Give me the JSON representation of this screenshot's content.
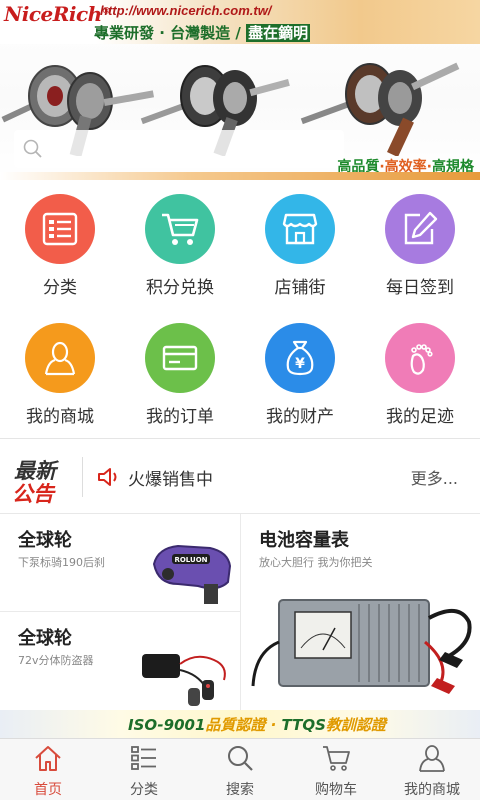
{
  "banner": {
    "brand": "NiceRich",
    "brand_mark": "®",
    "url": "http://www.nicerich.com.tw/",
    "slogan_a": "專業研發 · 台灣製造 / ",
    "slogan_b": "盡在鏑明",
    "tagline_a": "高品質",
    "tagline_sep": "·",
    "tagline_b": "高效率",
    "tagline_c": "高規格"
  },
  "search": {
    "icon": "search-icon"
  },
  "grid": [
    {
      "label": "分类",
      "icon": "list-icon",
      "color": "#f25d4a"
    },
    {
      "label": "积分兑换",
      "icon": "cart-icon",
      "color": "#40c3a0"
    },
    {
      "label": "店铺街",
      "icon": "shop-icon",
      "color": "#33b6e8"
    },
    {
      "label": "每日签到",
      "icon": "edit-icon",
      "color": "#a77be0"
    },
    {
      "label": "我的商城",
      "icon": "user-icon",
      "color": "#f59a1c"
    },
    {
      "label": "我的订单",
      "icon": "card-icon",
      "color": "#6cc04a"
    },
    {
      "label": "我的财产",
      "icon": "money-bag-icon",
      "color": "#2b8ce8"
    },
    {
      "label": "我的足迹",
      "icon": "footprint-icon",
      "color": "#f07cb7"
    }
  ],
  "notice": {
    "logo_line1": "最新",
    "logo_line2": "公告",
    "text": "火爆销售中",
    "more": "更多..."
  },
  "products": [
    {
      "title": "全球轮",
      "subtitle": "下泵标骑190后刹"
    },
    {
      "title": "全球轮",
      "subtitle": "72v分体防盗器"
    },
    {
      "title": "电池容量表",
      "subtitle": "放心大胆行  我为你把关"
    }
  ],
  "strip": {
    "text_a": "ISO-9001",
    "text_b": "品質認證 · ",
    "text_c": "TTQS",
    "text_d": "教訓認證"
  },
  "tabbar": [
    {
      "label": "首页",
      "icon": "home-icon",
      "active": true
    },
    {
      "label": "分类",
      "icon": "list-icon"
    },
    {
      "label": "搜索",
      "icon": "search-icon"
    },
    {
      "label": "购物车",
      "icon": "cart-icon"
    },
    {
      "label": "我的商城",
      "icon": "user-icon"
    }
  ],
  "colors": {
    "accent": "#d84b3c",
    "brand": "#c81d1d",
    "green": "#1d6e2a"
  }
}
